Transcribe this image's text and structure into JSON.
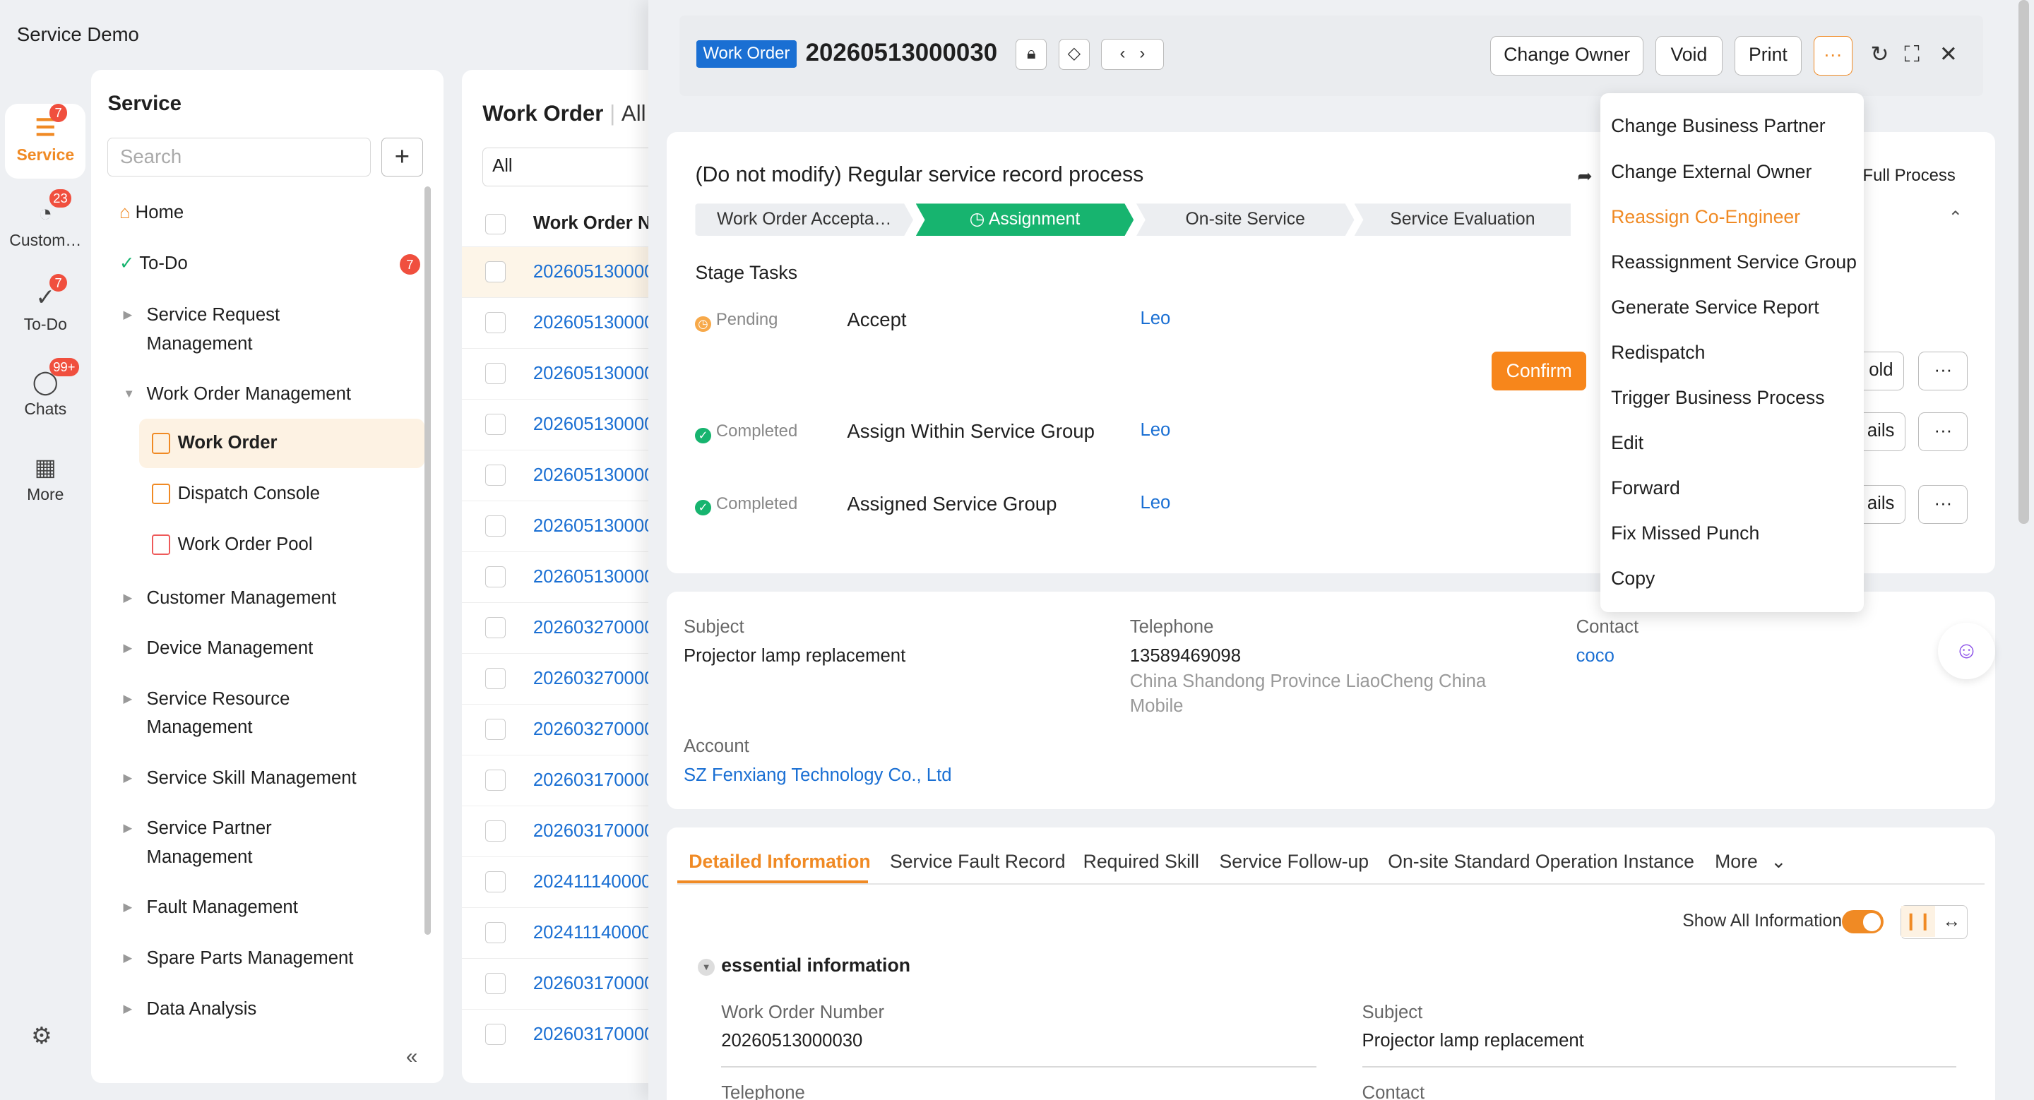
{
  "app": {
    "title": "Service Demo"
  },
  "rail": [
    {
      "label": "Service",
      "badge": "7",
      "icon": "service-icon"
    },
    {
      "label": "Custom…",
      "badge": "23",
      "icon": "customer-icon"
    },
    {
      "label": "To-Do",
      "badge": "7",
      "icon": "todo-icon"
    },
    {
      "label": "Chats",
      "badge": "99+",
      "icon": "chat-icon"
    },
    {
      "label": "More",
      "badge": "",
      "icon": "grid-icon"
    }
  ],
  "nav": {
    "title": "Service",
    "search_placeholder": "Search",
    "home": "Home",
    "todo": "To-Do",
    "todo_badge": "7",
    "items": {
      "srm1": "Service Request",
      "srm2": "Management",
      "wom": "Work Order Management",
      "wo": "Work Order",
      "dc": "Dispatch Console",
      "wop": "Work Order Pool",
      "cm": "Customer Management",
      "dm": "Device Management",
      "sr1": "Service Resource",
      "sr2": "Management",
      "ssm": "Service Skill Management",
      "sp1": "Service Partner",
      "sp2": "Management",
      "fm": "Fault Management",
      "spm": "Spare Parts Management",
      "da": "Data Analysis"
    }
  },
  "list": {
    "title": "Work Order",
    "view": "All",
    "filter": "All",
    "column": "Work Order N",
    "rows": [
      "202605130000",
      "202605130000",
      "202605130000",
      "202605130000",
      "202605130000",
      "202605130000",
      "202605130000",
      "202603270000",
      "202603270000",
      "202603270000",
      "202603170000",
      "202603170000",
      "202411140000",
      "202411140000",
      "202603170000",
      "202603170000"
    ]
  },
  "detail": {
    "tag": "Work Order",
    "number": "20260513000030",
    "buttons": {
      "change_owner": "Change Owner",
      "void": "Void",
      "print": "Print",
      "more": "···"
    },
    "process_title": "(Do not modify) Regular service record process",
    "full_process": "Full Process",
    "stages": [
      "Work Order Accepta…",
      "Assignment",
      "On-site Service",
      "Service Evaluation"
    ],
    "stage_tasks": "Stage Tasks",
    "tasks": [
      {
        "status": "Pending",
        "name": "Accept",
        "user": "Leo"
      },
      {
        "status": "Completed",
        "name": "Assign Within Service Group",
        "user": "Leo"
      },
      {
        "status": "Completed",
        "name": "Assigned Service Group",
        "user": "Leo"
      }
    ],
    "confirm": "Confirm",
    "btn_hold": "old",
    "btn_details": "ails",
    "btn_more": "···"
  },
  "dropdown": [
    "Change Business Partner",
    "Change External Owner",
    "Reassign Co-Engineer",
    "Reassignment Service Group",
    "Generate Service Report",
    "Redispatch",
    "Trigger Business Process",
    "Edit",
    "Forward",
    "Fix Missed Punch",
    "Copy"
  ],
  "info": {
    "subject_label": "Subject",
    "subject": "Projector lamp replacement",
    "telephone_label": "Telephone",
    "telephone": "13589469098",
    "location1": "China Shandong Province LiaoCheng China",
    "location2": "Mobile",
    "contact_label": "Contact",
    "contact": "coco",
    "account_label": "Account",
    "account": "SZ Fenxiang Technology Co., Ltd"
  },
  "tabs": [
    "Detailed Information",
    "Service Fault Record",
    "Required Skill",
    "Service Follow-up",
    "On-site Standard Operation Instance",
    "More"
  ],
  "details": {
    "show_all": "Show All Information",
    "section": "essential information",
    "won_label": "Work Order Number",
    "won": "20260513000030",
    "subject_label": "Subject",
    "subject": "Projector lamp replacement",
    "tel_label": "Telephone",
    "contact_label": "Contact"
  },
  "colors": {
    "accent": "#f08a24",
    "link": "#1a6fd3",
    "stage_active": "#17b46f",
    "badge": "#f04f3e"
  }
}
